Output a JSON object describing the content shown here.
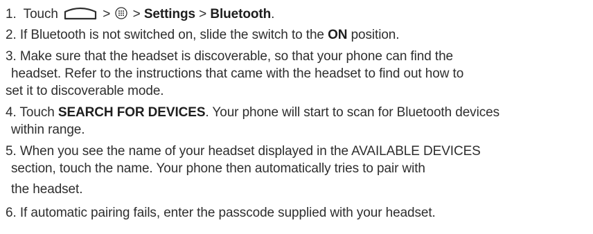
{
  "steps": [
    {
      "num": "1.",
      "pre": "Touch",
      "sep1": ">",
      "sep2": ">",
      "settings": "Settings",
      "sep3": ">",
      "bluetooth": "Bluetooth",
      "end": "."
    },
    {
      "num": "2.",
      "pre": "If Bluetooth is not switched on, slide the switch to the",
      "bold": "ON",
      "post": "position."
    },
    {
      "num": "3.",
      "lines": [
        "Make sure that the headset is discoverable, so that your phone can find the",
        "headset. Refer to the instructions that came with the headset to find out how to",
        "set it to discoverable mode."
      ]
    },
    {
      "num": "4.",
      "pre": "Touch",
      "bold": "SEARCH FOR DEVICES",
      "post": ". Your phone will start to scan for Bluetooth devices",
      "line2": "within range."
    },
    {
      "num": "5.",
      "lines": [
        "When you see the name of your headset displayed in the AVAILABLE DEVICES",
        "section, touch the name. Your phone then automatically tries to pair with",
        "the headset."
      ]
    },
    {
      "num": "6.",
      "text": "If automatic pairing fails, enter the passcode supplied with your headset."
    }
  ],
  "icons": {
    "home": "home-icon",
    "apps": "all-apps-icon"
  }
}
